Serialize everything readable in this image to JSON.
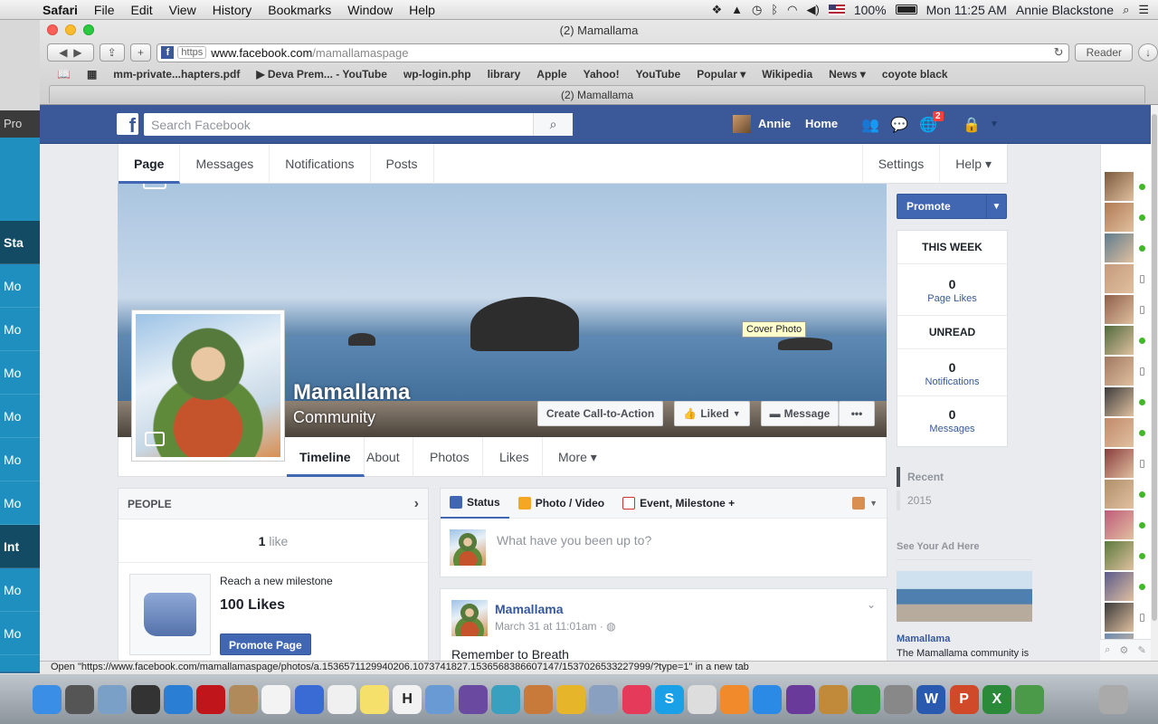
{
  "menubar": {
    "apple": "",
    "items": [
      "Safari",
      "File",
      "Edit",
      "View",
      "History",
      "Bookmarks",
      "Window",
      "Help"
    ],
    "battery": "100%",
    "clock": "Mon 11:25 AM",
    "user": "Annie Blackstone"
  },
  "background_app": {
    "items": [
      "Pro",
      "Sta",
      "Mo",
      "Mo",
      "Mo",
      "Mo",
      "Mo",
      "Mo",
      "Int",
      "Mo",
      "Mo"
    ]
  },
  "safari": {
    "window_title": "(2) Mamallama",
    "address": {
      "scheme_badge": "https",
      "host": "www.facebook.com",
      "path": "/mamallamaspage"
    },
    "reader_label": "Reader",
    "bookmarks": [
      "mm-private...hapters.pdf",
      "▶ Deva Prem... - YouTube",
      "wp-login.php",
      "library",
      "Apple",
      "Yahoo!",
      "YouTube",
      "Popular ▾",
      "Wikipedia",
      "News ▾",
      "coyote black"
    ],
    "tab_title": "(2) Mamallama",
    "status_text": "Open \"https://www.facebook.com/mamallamaspage/photos/a.1536571129940206.1073741827.1536568386607147/1537026533227999/?type=1\" in a new tab"
  },
  "fb_header": {
    "logo": "f",
    "search_placeholder": "Search Facebook",
    "user_name": "Annie",
    "home_label": "Home",
    "notif_count": "2"
  },
  "page_tabs": {
    "left": [
      "Page",
      "Messages",
      "Notifications",
      "Posts"
    ],
    "right": [
      "Settings",
      "Help ▾"
    ]
  },
  "cover": {
    "tooltip": "Cover Photo",
    "page_name": "Mamallama",
    "category": "Community",
    "cta_label": "Create Call-to-Action",
    "liked_label": "Liked",
    "message_label": "Message",
    "more_label": "•••"
  },
  "timeline_tabs": [
    "Timeline",
    "About",
    "Photos",
    "Likes",
    "More ▾"
  ],
  "right_col": {
    "promote_label": "Promote",
    "this_week": "THIS WEEK",
    "page_likes_num": "0",
    "page_likes_lbl": "Page Likes",
    "unread": "UNREAD",
    "notifications_num": "0",
    "notifications_lbl": "Notifications",
    "messages_num": "0",
    "messages_lbl": "Messages",
    "recent_label": "Recent",
    "year_label": "2015",
    "ad_header": "See Your Ad Here",
    "ad_name": "Mamallama",
    "ad_text": "The Mamallama community is"
  },
  "people": {
    "header": "PEOPLE",
    "like_count": "1",
    "like_word": "like",
    "milestone_title": "Reach a new milestone",
    "milestone_count": "100 Likes",
    "promote_page": "Promote Page"
  },
  "composer": {
    "tabs": [
      "Status",
      "Photo / Video",
      "Event, Milestone +"
    ],
    "placeholder": "What have you been up to?"
  },
  "post": {
    "author": "Mamallama",
    "date": "March 31 at 11:01am · ",
    "text": "Remember to Breath"
  },
  "colors": {
    "fb_blue": "#3b5998",
    "button_blue": "#4267b2",
    "online_green": "#42b72a"
  }
}
